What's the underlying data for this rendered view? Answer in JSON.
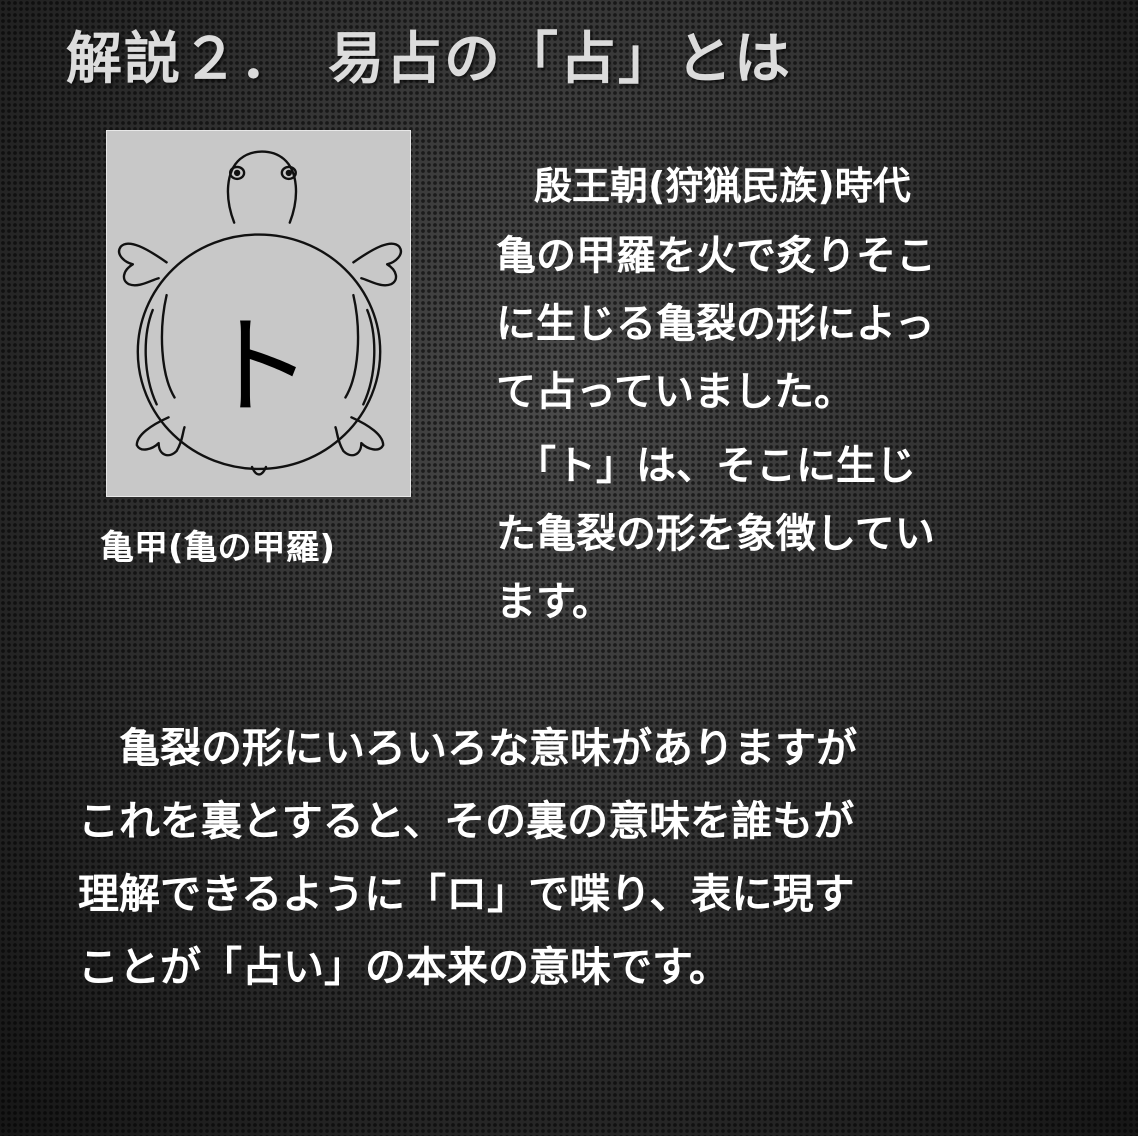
{
  "title": "解説２．　易占の「占」とは",
  "figure": {
    "glyph": "ト",
    "caption": "亀甲(亀の甲羅)"
  },
  "side": {
    "era": "　殷王朝(狩猟民族)時代",
    "lines1": [
      "亀の甲羅を火で炙りそこ",
      "に生じる亀裂の形によっ",
      "て占っていました。"
    ],
    "lines2": [
      "　「ト」は、そこに生じ",
      "た亀裂の形を象徴してい",
      "ます。"
    ]
  },
  "main": {
    "lines": [
      "　亀裂の形にいろいろな意味がありますが",
      "これを裏とすると、その裏の意味を誰もが",
      "理解できるように「ロ」で喋り、表に現す",
      "ことが「占い」の本来の意味です。"
    ]
  }
}
